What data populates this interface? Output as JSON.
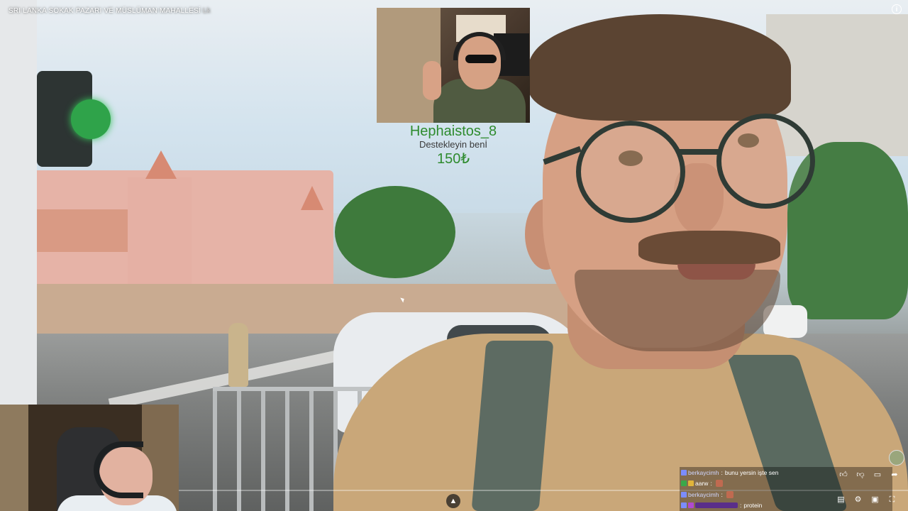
{
  "video": {
    "title": "SRI LANKA SOKAK PAZARI VE MÜSLÜMAN MAHALLESİ",
    "title_suffix": "Lk",
    "info_icon_label": "i"
  },
  "donation_alert": {
    "username": "Hephaistos_8",
    "message": "Desteklеyin benİ",
    "amount": "150₺"
  },
  "chat": {
    "messages": [
      {
        "user": "berkaycimh",
        "text": "bunu yersin işte sen",
        "badge_color": "#7b8cff",
        "user_color": "#cfd6ff",
        "emote": false
      },
      {
        "user": "aarw",
        "text": "",
        "badge_color": "#e0b43a",
        "user_color": "#ffffff",
        "emote": true
      },
      {
        "user": "berkaycimh",
        "text": "",
        "badge_color": "#7b8cff",
        "user_color": "#cfd6ff",
        "emote": true
      },
      {
        "user": "",
        "text": "protein",
        "badge_color": "#b04ad0",
        "user_color": "#9b5ad6",
        "emote": false
      }
    ]
  },
  "controls": {
    "expand_icon": "chevron-up-icon",
    "actions": [
      "thumbs-up-icon",
      "thumbs-down-icon",
      "comment-icon",
      "share-icon"
    ],
    "bottom": [
      "subtitles-icon",
      "settings-icon",
      "miniplayer-icon",
      "fullscreen-icon"
    ]
  },
  "colors": {
    "alert_green": "#2e8b2e",
    "progress_track": "rgba(255,255,255,0.35)"
  }
}
